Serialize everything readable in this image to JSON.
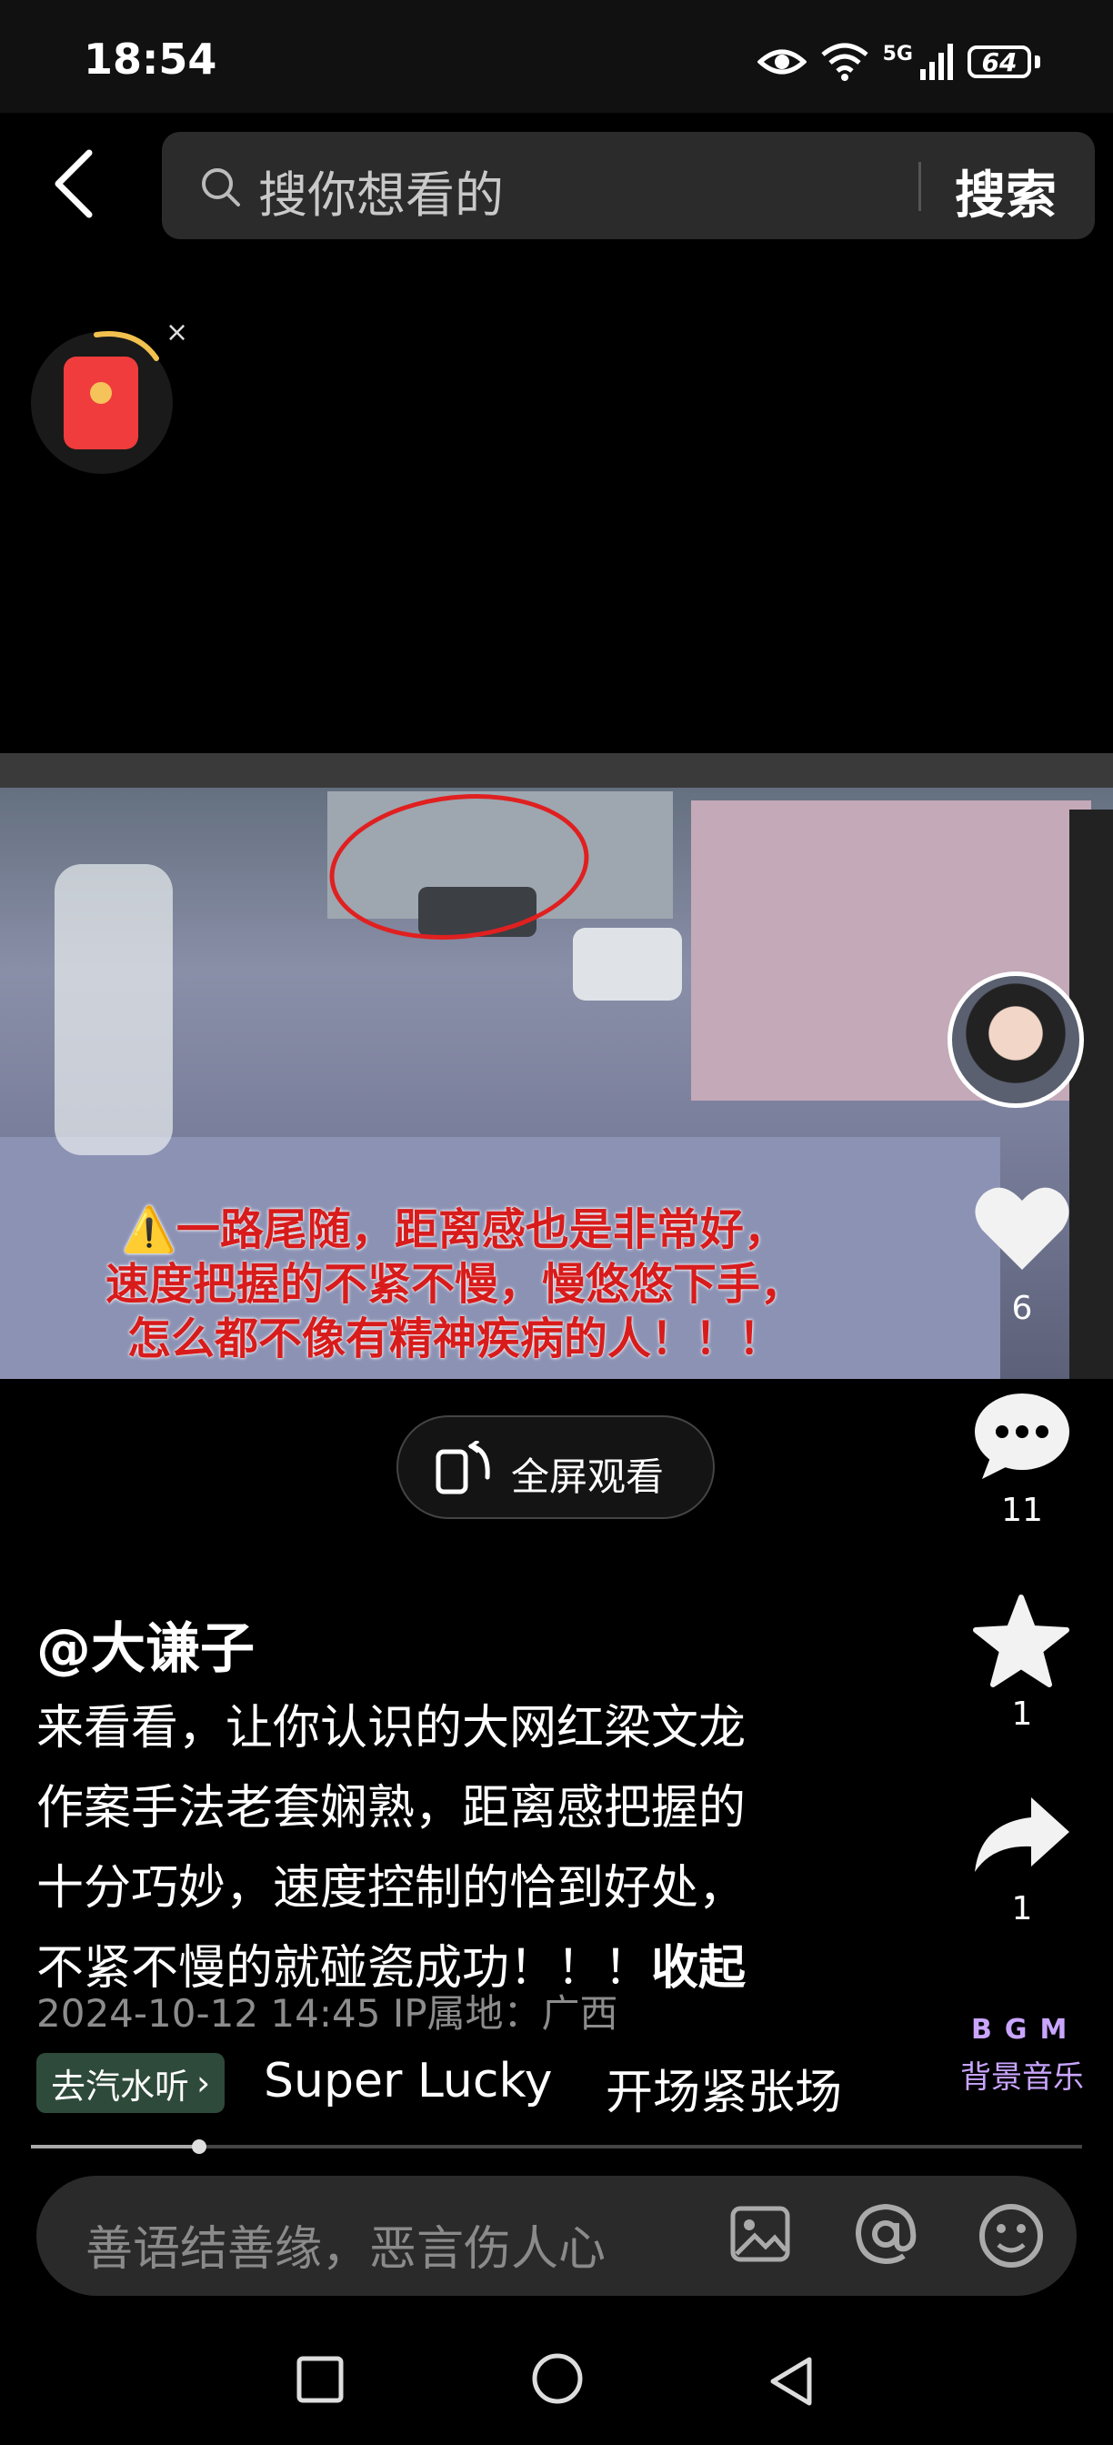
{
  "status_bar": {
    "time": "18:54",
    "network": "5G",
    "battery": "64"
  },
  "search": {
    "placeholder": "搜你想看的",
    "button": "搜索"
  },
  "video": {
    "caption_lines": [
      "⚠️一路尾随，距离感也是非常好，",
      "速度把握的不紧不慢，慢悠悠下手，",
      "怎么都不像有精神疾病的人！！！"
    ]
  },
  "actions": {
    "likes": "6",
    "comments": "11",
    "favorites": "1",
    "shares": "1"
  },
  "fullscreen_label": "全屏观看",
  "post": {
    "author": "@大谦子",
    "description_lines": [
      "来看看，让你认识的大网红梁文龙",
      "作案手法老套娴熟，距离感把握的",
      "十分巧妙，速度控制的恰到好处，",
      "不紧不慢的就碰瓷成功！！！"
    ],
    "collapse": "收起",
    "meta": "2024-10-12 14:45  IP属地：广西"
  },
  "music": {
    "tag": "去汽水听",
    "songs": [
      "Super Lucky",
      "开场紧张场"
    ],
    "bgm_title": "BGM",
    "bgm_label": "背景音乐"
  },
  "progress": 0.16,
  "comment": {
    "placeholder": "善语结善缘，恶言伤人心"
  },
  "colors": {
    "background": "#000000",
    "caption_red": "#d81b1b",
    "bgm_purple": "#c9a5ff",
    "music_tag_green": "#2e4a3a"
  }
}
